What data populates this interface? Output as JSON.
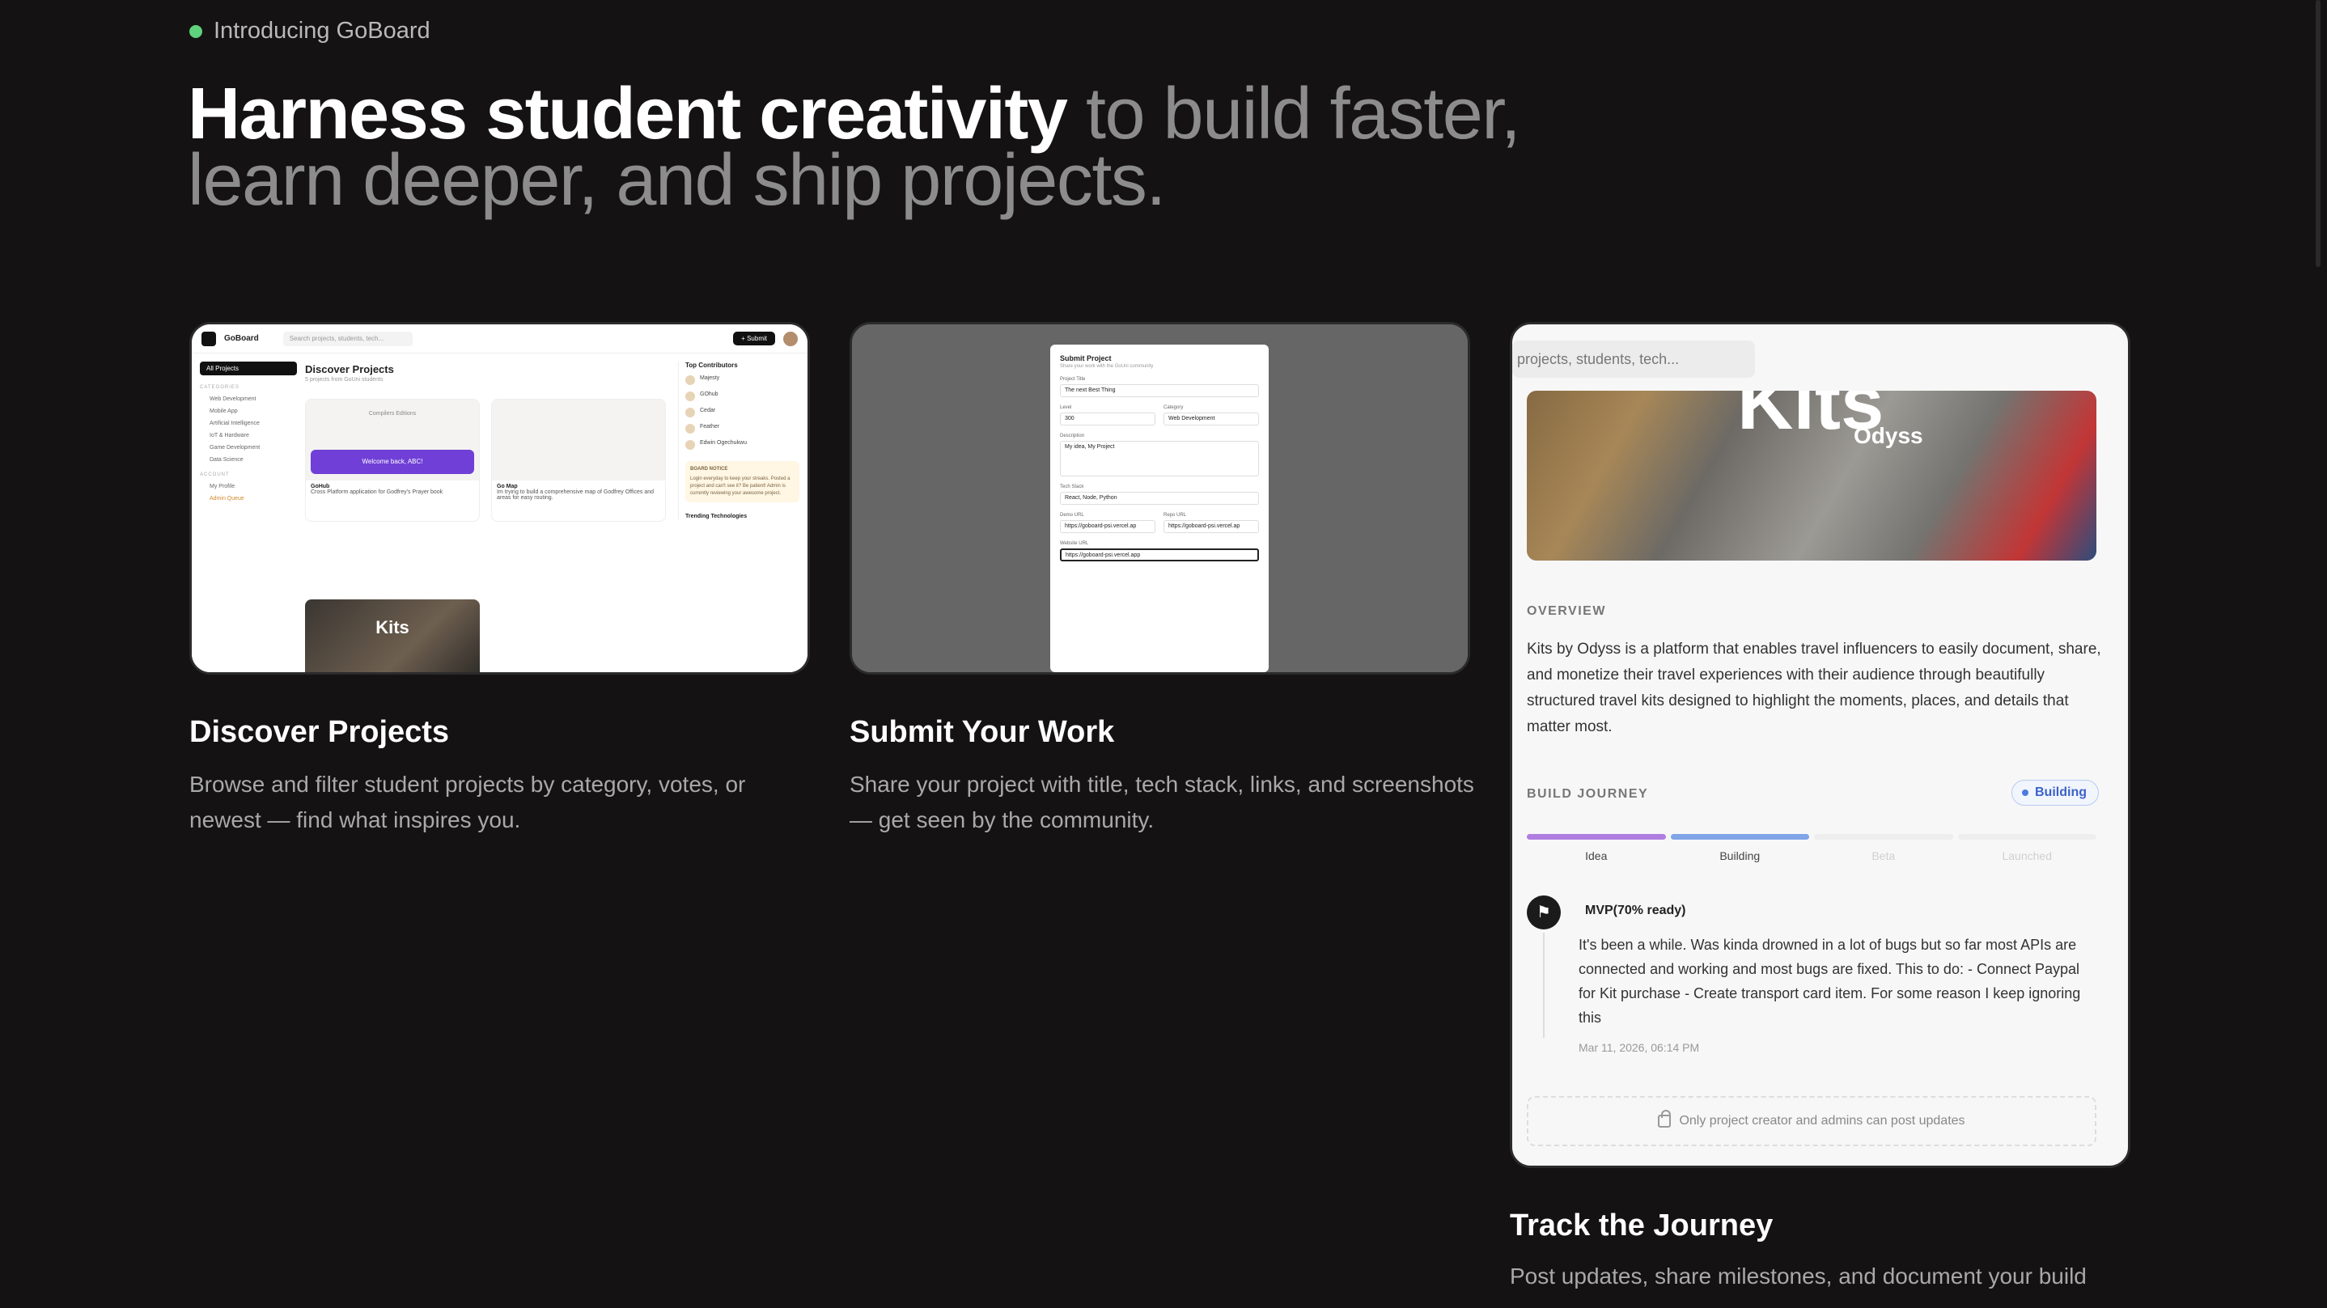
{
  "intro": {
    "label": "Introducing GoBoard",
    "dot_color": "#5fd27d"
  },
  "hero": {
    "strong": "Harness student creativity",
    "muted": " to build faster, learn deeper, and ship projects."
  },
  "features": [
    {
      "title": "Discover Projects",
      "description": "Browse and filter student projects by category, votes, or newest — find what inspires you."
    },
    {
      "title": "Submit Your Work",
      "description": "Share your project with title, tech stack, links, and screenshots — get seen by the community."
    },
    {
      "title": "Track the Journey",
      "description": "Post updates, share milestones, and document your build"
    }
  ],
  "mini_app": {
    "brand": "GoBoard",
    "search_placeholder": "Search projects, students, tech...",
    "submit": "+ Submit",
    "side_active": "All Projects",
    "side_label": "CATEGORIES",
    "side_items": [
      "Web Development",
      "Mobile App",
      "Artificial Intelligence",
      "IoT & Hardware",
      "Game Development",
      "Data Science"
    ],
    "account_label": "ACCOUNT",
    "account_items": [
      "My Profile",
      "Admin Queue"
    ],
    "page_title": "Discover Projects",
    "page_sub": "5 projects from GoUni students",
    "cards": [
      {
        "title": "GoHub",
        "meta": "Compilers Editions",
        "desc": "Cross Platform application for Godfrey's Prayer book",
        "banner": "Welcome back, ABC!"
      },
      {
        "title": "Go Map",
        "desc": "Im trying to build a comprehensive map of Godfrey Offices and areas for easy routing."
      }
    ],
    "kits": "Kits",
    "right_title": "Top Contributors",
    "contributors": [
      "Majesty",
      "GOhub",
      "Cedar",
      "Feather",
      "Edwin Ogechukwu"
    ],
    "notice_title": "BOARD NOTICE",
    "notice": "Login everyday to keep your streaks. Posted a project and can't see it? Be patient! Admin is currently reviewing your awesome project.",
    "trending": "Trending Technologies"
  },
  "submit_modal": {
    "title": "Submit Project",
    "subtitle": "Share your work with the GoUni community",
    "project_title_label": "Project Title",
    "project_title": "The next Best Thing",
    "level_label": "Level",
    "level": "300",
    "category_label": "Category",
    "category": "Web Development",
    "description_label": "Description",
    "description": "My idea, My Project",
    "tech_label": "Tech Stack",
    "tech": "React, Node, Python",
    "demo_label": "Demo URL",
    "demo": "https://goboard-psi.vercel.ap",
    "repo_label": "Repo URL",
    "repo": "https://goboard-psi.vercel.ap",
    "website_label": "Website URL",
    "website": "https://goboard-psi.vercel.app"
  },
  "journey_card": {
    "search_placeholder": "projects, students, tech...",
    "banner_title": "Kits",
    "banner_sub": "Odyss",
    "overview_label": "OVERVIEW",
    "overview": "Kits by Odyss is a platform that enables travel influencers to easily document, share, and monetize their travel experiences with their audience through beautifully structured travel kits designed to highlight the moments, places, and details that matter most.",
    "build_label": "BUILD JOURNEY",
    "status": "Building",
    "steps": [
      {
        "label": "Idea",
        "color": "#b07ee0",
        "active": true
      },
      {
        "label": "Building",
        "color": "#7fa4e8",
        "active": true
      },
      {
        "label": "Beta",
        "color": "#eeeeee",
        "active": false
      },
      {
        "label": "Launched",
        "color": "#eeeeee",
        "active": false
      }
    ],
    "update_title": "MVP(70% ready)",
    "update_body": "It's been a while. Was kinda drowned in a lot of bugs but so far most APIs are connected and working and most bugs are fixed. This to do: - Connect Paypal for Kit purchase - Create transport card item. For some reason I keep ignoring this",
    "update_date": "Mar 11, 2026, 06:14 PM",
    "locked_note": "Only project creator and admins can post updates"
  }
}
